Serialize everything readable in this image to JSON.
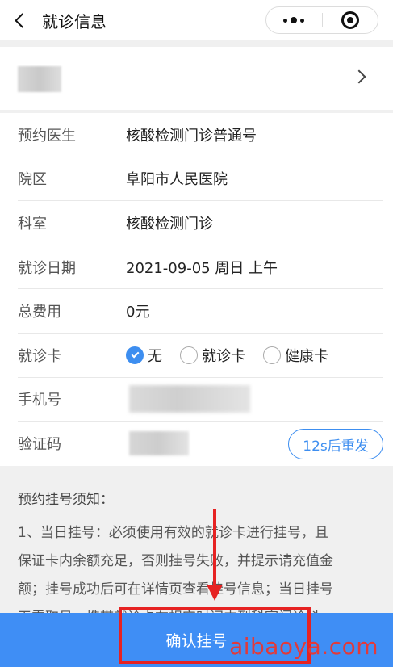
{
  "nav": {
    "title": "就诊信息",
    "back_icon": "chevron-left-icon",
    "more_icon": "more-dots-icon",
    "close_icon": "target-close-icon"
  },
  "patient": {
    "chevron_icon": "chevron-right-icon"
  },
  "form": {
    "doctor": {
      "label": "预约医生",
      "value": "核酸检测门诊普通号"
    },
    "campus": {
      "label": "院区",
      "value": "阜阳市人民医院"
    },
    "department": {
      "label": "科室",
      "value": "核酸检测门诊"
    },
    "date": {
      "label": "就诊日期",
      "value": "2021-09-05 周日 上午"
    },
    "fee": {
      "label": "总费用",
      "value": "0元"
    },
    "card": {
      "label": "就诊卡",
      "options": [
        "无",
        "就诊卡",
        "健康卡"
      ],
      "selected": "无"
    },
    "phone": {
      "label": "手机号"
    },
    "verify": {
      "label": "验证码",
      "resend_label": "12s后重发"
    }
  },
  "notice": {
    "title": "预约挂号须知：",
    "lines": [
      "1、当日挂号：必须使用有效的就诊卡进行挂号，且",
      "保证卡内余额充足，否则挂号失败，并提示请充值金",
      "额；挂号成功后可在详情页查看挂号信息；当日挂号",
      "无需取号，携带就诊卡在规定时间内到科室门诊科"
    ]
  },
  "confirm_label": "确认挂号",
  "watermark": "aibaoya.com",
  "colors": {
    "accent": "#3f8ef5",
    "annotation": "#e62222"
  }
}
